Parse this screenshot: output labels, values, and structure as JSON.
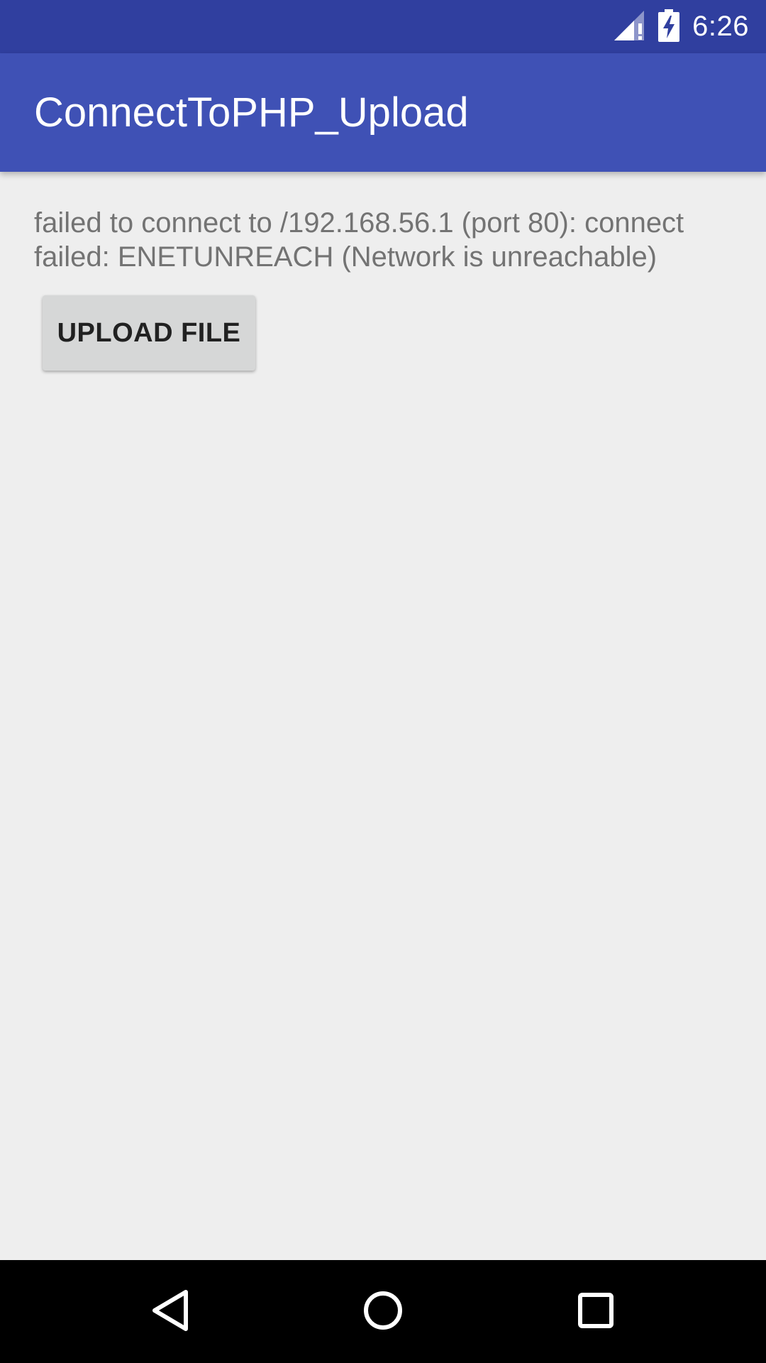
{
  "status_bar": {
    "time": "6:26",
    "icons": [
      "signal-no-data-icon",
      "battery-charging-icon"
    ],
    "background_color": "#303f9f"
  },
  "app_bar": {
    "title": "ConnectToPHP_Upload",
    "background_color": "#3f51b5"
  },
  "main": {
    "message": "failed to connect to /192.168.56.1 (port 80): connect failed: ENETUNREACH (Network is unreachable)",
    "upload_button_label": "UPLOAD FILE"
  },
  "nav_bar": {
    "icons": [
      "back-icon",
      "home-icon",
      "recents-icon"
    ]
  }
}
